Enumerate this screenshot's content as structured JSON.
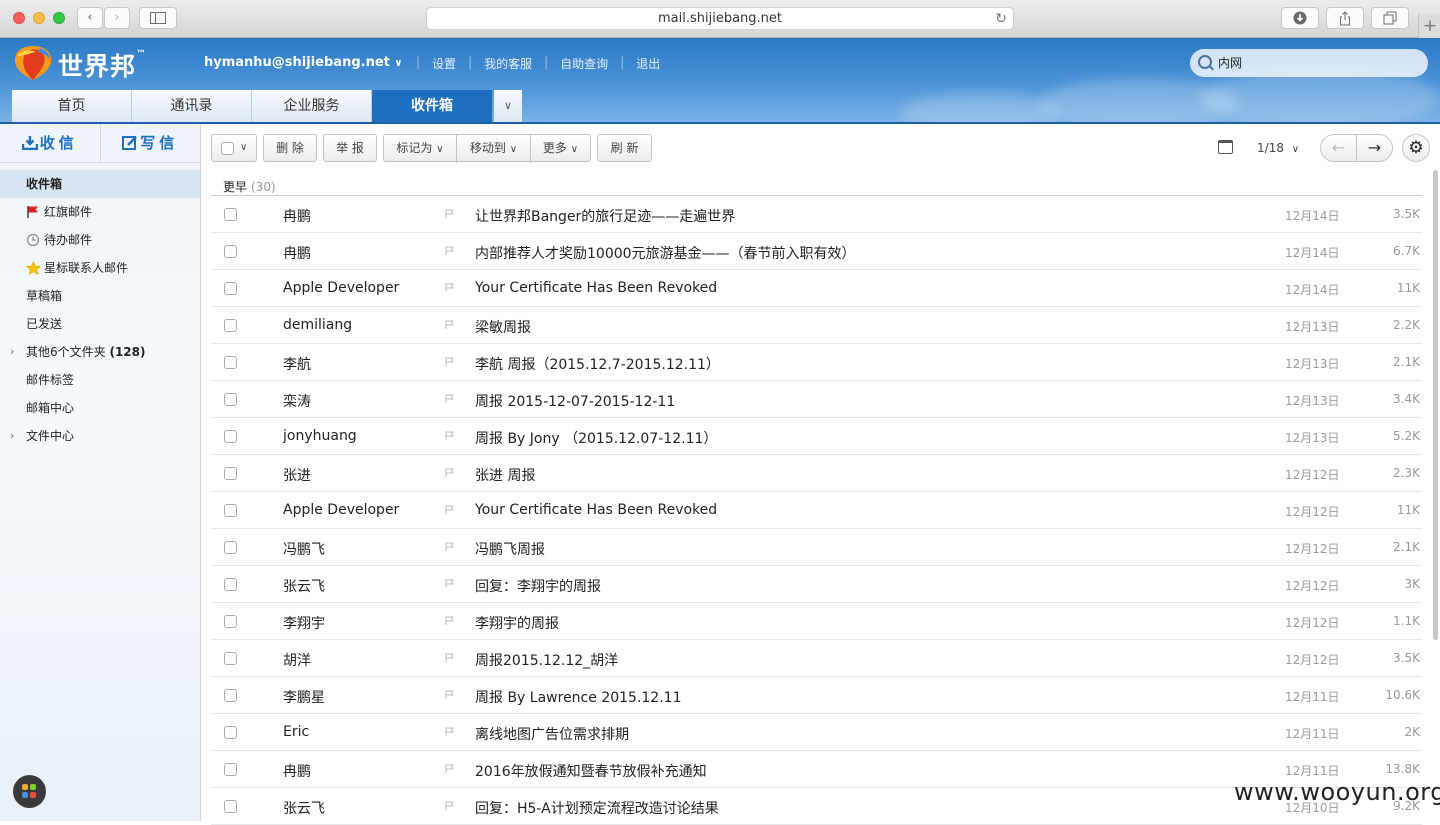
{
  "browser": {
    "url": "mail.shijiebang.net"
  },
  "header": {
    "brand": "世界邦",
    "brand_tm": "™",
    "account": "hymanhu@shijiebang.net",
    "links": [
      "设置",
      "我的客服",
      "自助查询",
      "退出"
    ],
    "search_value": "内网",
    "tabs": [
      {
        "label": "首页"
      },
      {
        "label": "通讯录"
      },
      {
        "label": "企业服务"
      },
      {
        "label": "收件箱"
      }
    ],
    "active_tab": "收件箱"
  },
  "sidebar": {
    "receive_label": "收信",
    "compose_label": "写信",
    "folders": [
      {
        "label": "收件箱"
      },
      {
        "label": "红旗邮件"
      },
      {
        "label": "待办邮件"
      },
      {
        "label": "星标联系人邮件"
      },
      {
        "label": "草稿箱"
      },
      {
        "label": "已发送"
      },
      {
        "label": "其他6个文件夹",
        "count": "(128)"
      },
      {
        "label": "邮件标签"
      },
      {
        "label": "邮箱中心"
      },
      {
        "label": "文件中心"
      }
    ]
  },
  "toolbar": {
    "delete_label": "删 除",
    "report_label": "举 报",
    "mark_label": "标记为",
    "move_label": "移动到",
    "more_label": "更多",
    "refresh_label": "刷 新",
    "page_indicator": "1/18"
  },
  "mail_list": {
    "group_label": "更早",
    "group_count": "(30)",
    "rows": [
      {
        "from": "冉鹏",
        "subject": "让世界邦Banger的旅行足迹——走遍世界",
        "date": "12月14日",
        "size": "3.5K"
      },
      {
        "from": "冉鹏",
        "subject": "内部推荐人才奖励10000元旅游基金——（春节前入职有效）",
        "date": "12月14日",
        "size": "6.7K"
      },
      {
        "from": "Apple Developer",
        "subject": "Your Certificate Has Been Revoked",
        "date": "12月14日",
        "size": "11K"
      },
      {
        "from": "demiliang",
        "subject": "梁敏周报",
        "date": "12月13日",
        "size": "2.2K"
      },
      {
        "from": "李航",
        "subject": "李航 周报（2015.12.7-2015.12.11）",
        "date": "12月13日",
        "size": "2.1K"
      },
      {
        "from": "栾涛",
        "subject": "周报 2015-12-07-2015-12-11",
        "date": "12月13日",
        "size": "3.4K"
      },
      {
        "from": "jonyhuang",
        "subject": "周报 By Jony （2015.12.07-12.11）",
        "date": "12月13日",
        "size": "5.2K"
      },
      {
        "from": "张进",
        "subject": "张进 周报",
        "date": "12月12日",
        "size": "2.3K"
      },
      {
        "from": "Apple Developer",
        "subject": "Your Certificate Has Been Revoked",
        "date": "12月12日",
        "size": "11K"
      },
      {
        "from": "冯鹏飞",
        "subject": "冯鹏飞周报",
        "date": "12月12日",
        "size": "2.1K"
      },
      {
        "from": "张云飞",
        "subject": "回复：李翔宇的周报",
        "date": "12月12日",
        "size": "3K"
      },
      {
        "from": "李翔宇",
        "subject": "李翔宇的周报",
        "date": "12月12日",
        "size": "1.1K"
      },
      {
        "from": "胡洋",
        "subject": "周报2015.12.12_胡洋",
        "date": "12月12日",
        "size": "3.5K"
      },
      {
        "from": "李鹏星",
        "subject": "周报 By Lawrence 2015.12.11",
        "date": "12月11日",
        "size": "10.6K"
      },
      {
        "from": "Eric",
        "subject": "离线地图广告位需求排期",
        "date": "12月11日",
        "size": "2K"
      },
      {
        "from": "冉鹏",
        "subject": "2016年放假通知暨春节放假补充通知",
        "date": "12月11日",
        "size": "13.8K"
      },
      {
        "from": "张云飞",
        "subject": "回复：H5-A计划预定流程改造讨论结果",
        "date": "12月10日",
        "size": "9.2K"
      }
    ]
  },
  "watermark": "www.wooyun.org",
  "colors": {
    "header_blue": "#2a78c4",
    "active_tab": "#1f6fc0",
    "flag_red": "#e0201b",
    "star_yellow": "#f5c400"
  }
}
